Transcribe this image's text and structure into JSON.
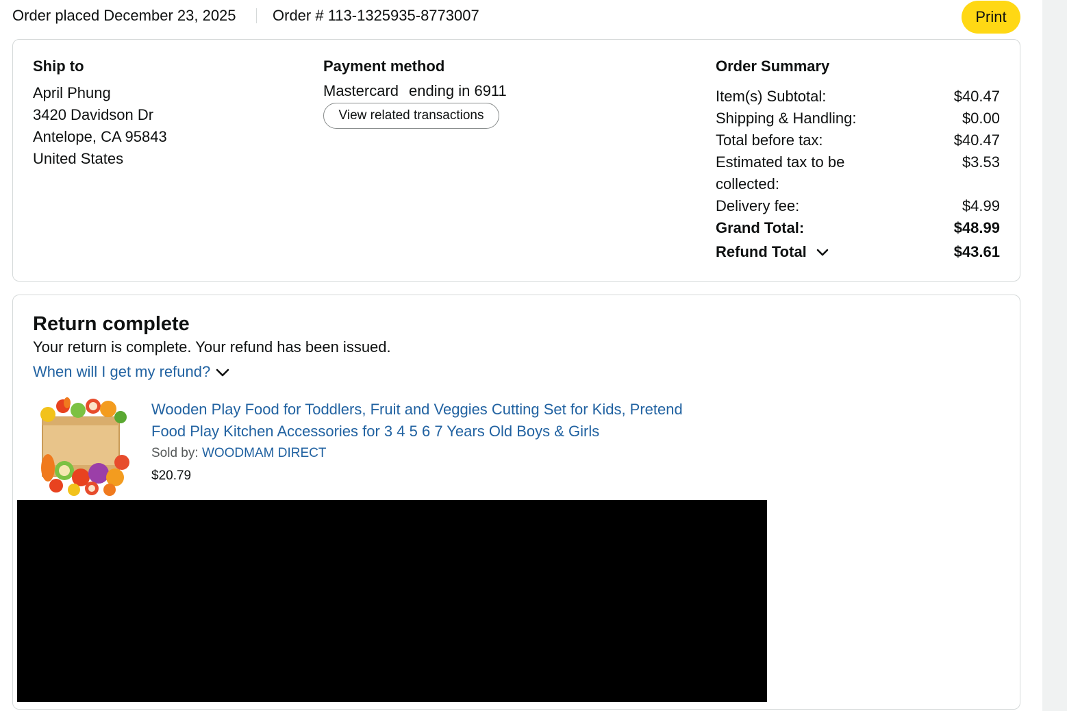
{
  "header": {
    "order_placed": "Order placed December 23, 2025",
    "order_number": "Order # 113-1325935-8773007",
    "print_label": "Print"
  },
  "ship_to": {
    "title": "Ship to",
    "name": "April Phung",
    "street": "3420 Davidson Dr",
    "city_line": "Antelope, CA 95843",
    "country": "United States"
  },
  "payment": {
    "title": "Payment method",
    "card_brand": "Mastercard",
    "card_ending": "ending in 6911",
    "view_transactions_label": "View related transactions"
  },
  "summary": {
    "title": "Order Summary",
    "rows": [
      {
        "label": "Item(s) Subtotal:",
        "value": "$40.47"
      },
      {
        "label": "Shipping & Handling:",
        "value": "$0.00"
      },
      {
        "label": "Total before tax:",
        "value": "$40.47"
      },
      {
        "label": "Estimated tax to be collected:",
        "value": "$3.53"
      },
      {
        "label": "Delivery fee:",
        "value": "$4.99"
      }
    ],
    "grand_total_label": "Grand Total:",
    "grand_total_value": "$48.99",
    "refund_total_label": "Refund Total",
    "refund_total_value": "$43.61"
  },
  "return": {
    "title": "Return complete",
    "message": "Your return is complete. Your refund has been issued.",
    "refund_link": "When will I get my refund?"
  },
  "product": {
    "title": "Wooden Play Food for Toddlers, Fruit and Veggies Cutting Set for Kids, Pretend Food Play Kitchen Accessories for 3 4 5 6 7 Years Old Boys & Girls",
    "sold_by_label": "Sold by:",
    "seller": "WOODMAM DIRECT",
    "price": "$20.79",
    "image_icon": "toy-food-crate-image"
  },
  "colors": {
    "print_button": "#ffd814",
    "link": "#2162a1",
    "text": "#0f1111",
    "border": "#d5d9d9"
  }
}
